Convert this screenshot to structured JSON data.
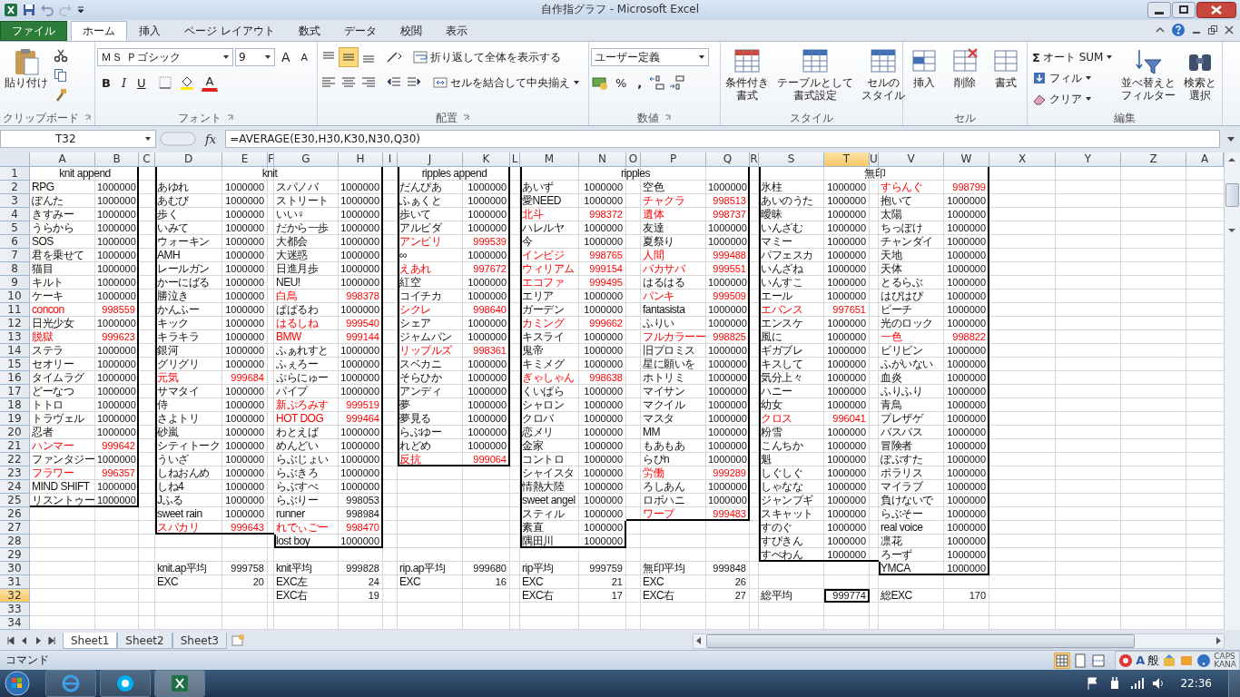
{
  "window": {
    "title": "自作指グラフ - Microsoft Excel"
  },
  "tabs": [
    {
      "label": "ファイル",
      "kind": "file",
      "selected": false
    },
    {
      "label": "ホーム",
      "kind": "tab",
      "selected": true
    },
    {
      "label": "挿入",
      "kind": "tab",
      "selected": false
    },
    {
      "label": "ページ レイアウト",
      "kind": "tab",
      "selected": false
    },
    {
      "label": "数式",
      "kind": "tab",
      "selected": false
    },
    {
      "label": "データ",
      "kind": "tab",
      "selected": false
    },
    {
      "label": "校閲",
      "kind": "tab",
      "selected": false
    },
    {
      "label": "表示",
      "kind": "tab",
      "selected": false
    }
  ],
  "ribbon": {
    "clipboard": {
      "label": "クリップボード",
      "paste": "貼り付け"
    },
    "font": {
      "label": "フォント",
      "font_name": "ＭＳ Ｐゴシック",
      "font_size": "9",
      "grow": "A",
      "shrink": "A",
      "bold": "B",
      "italic": "I",
      "underline": "U",
      "font_color": "A"
    },
    "alignment": {
      "label": "配置",
      "vertical": [
        {
          "selected": false
        },
        {
          "selected": true
        },
        {
          "selected": false
        }
      ],
      "wrap_text": "折り返して全体を表示する",
      "merge_center": "セルを結合して中央揃え"
    },
    "number": {
      "label": "数値",
      "format": "ユーザー定義",
      "percent": "%",
      "comma": ","
    },
    "styles": {
      "label": "スタイル",
      "buttons": [
        {
          "lines": [
            "条件付き",
            "書式"
          ]
        },
        {
          "lines": [
            "テーブルとして",
            "書式設定"
          ]
        },
        {
          "lines": [
            "セルの",
            "スタイル"
          ]
        }
      ]
    },
    "cells": {
      "label": "セル",
      "buttons": [
        "挿入",
        "削除",
        "書式"
      ]
    },
    "editing": {
      "label": "編集",
      "sum_symbol": "Σ",
      "autosum": "オート SUM",
      "fill": "フィル",
      "clear": "クリア",
      "sort": [
        "並べ替えと",
        "フィルター"
      ],
      "find": [
        "検索と",
        "選択"
      ]
    }
  },
  "formula_bar": {
    "name_box": "T32",
    "fx": "fx",
    "formula": "=AVERAGE(E30,H30,K30,N30,Q30)"
  },
  "sheet": {
    "columns": [
      {
        "label": "A",
        "selected": false
      },
      {
        "label": "B",
        "selected": false
      },
      {
        "label": "C",
        "selected": false
      },
      {
        "label": "D",
        "selected": false
      },
      {
        "label": "E",
        "selected": false
      },
      {
        "label": "F",
        "selected": false
      },
      {
        "label": "G",
        "selected": false
      },
      {
        "label": "H",
        "selected": false
      },
      {
        "label": "I",
        "selected": false
      },
      {
        "label": "J",
        "selected": false
      },
      {
        "label": "K",
        "selected": false
      },
      {
        "label": "L",
        "selected": false
      },
      {
        "label": "M",
        "selected": false
      },
      {
        "label": "N",
        "selected": false
      },
      {
        "label": "O",
        "selected": false
      },
      {
        "label": "P",
        "selected": false
      },
      {
        "label": "Q",
        "selected": false
      },
      {
        "label": "R",
        "selected": false
      },
      {
        "label": "S",
        "selected": false
      },
      {
        "label": "T",
        "selected": true
      },
      {
        "label": "U",
        "selected": false
      },
      {
        "label": "V",
        "selected": false
      },
      {
        "label": "W",
        "selected": false
      },
      {
        "label": "X",
        "selected": false
      },
      {
        "label": "Y",
        "selected": false
      },
      {
        "label": "Z",
        "selected": false
      },
      {
        "label": "A",
        "selected": false
      }
    ],
    "rows": [
      {
        "label": "1",
        "selected": false
      },
      {
        "label": "2",
        "selected": false
      },
      {
        "label": "3",
        "selected": false
      },
      {
        "label": "4",
        "selected": false
      },
      {
        "label": "5",
        "selected": false
      },
      {
        "label": "6",
        "selected": false
      },
      {
        "label": "7",
        "selected": false
      },
      {
        "label": "8",
        "selected": false
      },
      {
        "label": "9",
        "selected": false
      },
      {
        "label": "10",
        "selected": false
      },
      {
        "label": "11",
        "selected": false
      },
      {
        "label": "12",
        "selected": false
      },
      {
        "label": "13",
        "selected": false
      },
      {
        "label": "14",
        "selected": false
      },
      {
        "label": "15",
        "selected": false
      },
      {
        "label": "16",
        "selected": false
      },
      {
        "label": "17",
        "selected": false
      },
      {
        "label": "18",
        "selected": false
      },
      {
        "label": "19",
        "selected": false
      },
      {
        "label": "20",
        "selected": false
      },
      {
        "label": "21",
        "selected": false
      },
      {
        "label": "22",
        "selected": false
      },
      {
        "label": "23",
        "selected": false
      },
      {
        "label": "24",
        "selected": false
      },
      {
        "label": "25",
        "selected": false
      },
      {
        "label": "26",
        "selected": false
      },
      {
        "label": "27",
        "selected": false
      },
      {
        "label": "28",
        "selected": false
      },
      {
        "label": "29",
        "selected": false
      },
      {
        "label": "30",
        "selected": false
      },
      {
        "label": "31",
        "selected": false
      },
      {
        "label": "32",
        "selected": true
      },
      {
        "label": "33",
        "selected": false
      },
      {
        "label": "34",
        "selected": false
      }
    ]
  },
  "blocks": [
    {
      "title": "knit append",
      "lists": [
        {
          "songs": [
            {
              "name": "RPG",
              "score": "1000000",
              "highlighted": false
            },
            {
              "name": "ぽんた",
              "score": "1000000",
              "highlighted": false
            },
            {
              "name": "きすみー",
              "score": "1000000",
              "highlighted": false
            },
            {
              "name": "うらから",
              "score": "1000000",
              "highlighted": false
            },
            {
              "name": "SOS",
              "score": "1000000",
              "highlighted": false
            },
            {
              "name": "君を乗せて",
              "score": "1000000",
              "highlighted": false
            },
            {
              "name": "猫目",
              "score": "1000000",
              "highlighted": false
            },
            {
              "name": "キルト",
              "score": "1000000",
              "highlighted": false
            },
            {
              "name": "ケーキ",
              "score": "1000000",
              "highlighted": false
            },
            {
              "name": "concon",
              "score": "998559",
              "highlighted": true
            },
            {
              "name": "日光少女",
              "score": "1000000",
              "highlighted": false
            },
            {
              "name": "脱獄",
              "score": "999623",
              "highlighted": true
            },
            {
              "name": "ステラ",
              "score": "1000000",
              "highlighted": false
            },
            {
              "name": "セオリー",
              "score": "1000000",
              "highlighted": false
            },
            {
              "name": "タイムラグ",
              "score": "1000000",
              "highlighted": false
            },
            {
              "name": "どーなつ",
              "score": "1000000",
              "highlighted": false
            },
            {
              "name": "トトロ",
              "score": "1000000",
              "highlighted": false
            },
            {
              "name": "トラヴェル",
              "score": "1000000",
              "highlighted": false
            },
            {
              "name": "忍者",
              "score": "1000000",
              "highlighted": false
            },
            {
              "name": "ハンマー",
              "score": "999642",
              "highlighted": true
            },
            {
              "name": "ファンタジー",
              "score": "1000000",
              "highlighted": false
            },
            {
              "name": "フラワー",
              "score": "996357",
              "highlighted": true
            },
            {
              "name": "MIND SHIFT",
              "score": "1000000",
              "highlighted": false
            },
            {
              "name": "リスントゥー",
              "score": "1000000",
              "highlighted": false
            }
          ]
        }
      ]
    },
    {
      "title": "knit",
      "lists": [
        {
          "songs": [
            {
              "name": "あゆれ",
              "score": "1000000",
              "highlighted": false
            },
            {
              "name": "あむび",
              "score": "1000000",
              "highlighted": false
            },
            {
              "name": "歩く",
              "score": "1000000",
              "highlighted": false
            },
            {
              "name": "いみて",
              "score": "1000000",
              "highlighted": false
            },
            {
              "name": "ウォーキン",
              "score": "1000000",
              "highlighted": false
            },
            {
              "name": "AMH",
              "score": "1000000",
              "highlighted": false
            },
            {
              "name": "レールガン",
              "score": "1000000",
              "highlighted": false
            },
            {
              "name": "かーにばる",
              "score": "1000000",
              "highlighted": false
            },
            {
              "name": "勝泣き",
              "score": "1000000",
              "highlighted": false
            },
            {
              "name": "かんふー",
              "score": "1000000",
              "highlighted": false
            },
            {
              "name": "キック",
              "score": "1000000",
              "highlighted": false
            },
            {
              "name": "キラキラ",
              "score": "1000000",
              "highlighted": false
            },
            {
              "name": "銀河",
              "score": "1000000",
              "highlighted": false
            },
            {
              "name": "グリグリ",
              "score": "1000000",
              "highlighted": false
            },
            {
              "name": "元気",
              "score": "999684",
              "highlighted": true
            },
            {
              "name": "サマタイ",
              "score": "1000000",
              "highlighted": false
            },
            {
              "name": "侍",
              "score": "1000000",
              "highlighted": false
            },
            {
              "name": "さよトリ",
              "score": "1000000",
              "highlighted": false
            },
            {
              "name": "砂嵐",
              "score": "1000000",
              "highlighted": false
            },
            {
              "name": "シティトーク",
              "score": "1000000",
              "highlighted": false
            },
            {
              "name": "ういざ",
              "score": "1000000",
              "highlighted": false
            },
            {
              "name": "しねおんめ",
              "score": "1000000",
              "highlighted": false
            },
            {
              "name": "しね4",
              "score": "1000000",
              "highlighted": false
            },
            {
              "name": "Jふる",
              "score": "1000000",
              "highlighted": false
            },
            {
              "name": "sweet rain",
              "score": "1000000",
              "highlighted": false
            },
            {
              "name": "スパカリ",
              "score": "999643",
              "highlighted": true
            }
          ],
          "stats": [
            {
              "label": "knit.ap平均",
              "value": "999758",
              "selected": false
            },
            {
              "label": "EXC",
              "value": "20",
              "selected": false
            }
          ]
        },
        {
          "songs": [
            {
              "name": "スパノバ",
              "score": "1000000",
              "highlighted": false
            },
            {
              "name": "ストリート",
              "score": "1000000",
              "highlighted": false
            },
            {
              "name": "いい♀",
              "score": "1000000",
              "highlighted": false
            },
            {
              "name": "だから一歩",
              "score": "1000000",
              "highlighted": false
            },
            {
              "name": "大都会",
              "score": "1000000",
              "highlighted": false
            },
            {
              "name": "大迷惑",
              "score": "1000000",
              "highlighted": false
            },
            {
              "name": "日進月歩",
              "score": "1000000",
              "highlighted": false
            },
            {
              "name": "NEU!",
              "score": "1000000",
              "highlighted": false
            },
            {
              "name": "白鳥",
              "score": "998378",
              "highlighted": true
            },
            {
              "name": "ぱぱるわ",
              "score": "1000000",
              "highlighted": false
            },
            {
              "name": "はるしね",
              "score": "999540",
              "highlighted": true
            },
            {
              "name": "BMW",
              "score": "999144",
              "highlighted": true
            },
            {
              "name": "ふぁれすと",
              "score": "1000000",
              "highlighted": false
            },
            {
              "name": "ふぇろー",
              "score": "1000000",
              "highlighted": false
            },
            {
              "name": "ぷらにゅー",
              "score": "1000000",
              "highlighted": false
            },
            {
              "name": "パイプ",
              "score": "1000000",
              "highlighted": false
            },
            {
              "name": "新ぷろみす",
              "score": "999519",
              "highlighted": true
            },
            {
              "name": "HOT DOG",
              "score": "999464",
              "highlighted": true
            },
            {
              "name": "わとえば",
              "score": "1000000",
              "highlighted": false
            },
            {
              "name": "めんどい",
              "score": "1000000",
              "highlighted": false
            },
            {
              "name": "らぶじょい",
              "score": "1000000",
              "highlighted": false
            },
            {
              "name": "らぶきろ",
              "score": "1000000",
              "highlighted": false
            },
            {
              "name": "らぶすべ",
              "score": "1000000",
              "highlighted": false
            },
            {
              "name": "らぶりー",
              "score": "998053",
              "highlighted": false
            },
            {
              "name": "runner",
              "score": "998984",
              "highlighted": false
            },
            {
              "name": "れでぃごー",
              "score": "998470",
              "highlighted": true
            },
            {
              "name": "lost boy",
              "score": "1000000",
              "highlighted": false
            }
          ],
          "stats": [
            {
              "label": "knit平均",
              "value": "999828",
              "selected": false
            },
            {
              "label": "EXC左",
              "value": "24",
              "selected": false
            },
            {
              "label": "EXC右",
              "value": "19",
              "selected": false
            }
          ]
        }
      ]
    },
    {
      "title": "ripples append",
      "lists": [
        {
          "songs": [
            {
              "name": "だんぴあ",
              "score": "1000000",
              "highlighted": false
            },
            {
              "name": "ふぁくと",
              "score": "1000000",
              "highlighted": false
            },
            {
              "name": "歩いて",
              "score": "1000000",
              "highlighted": false
            },
            {
              "name": "アルビダ",
              "score": "1000000",
              "highlighted": false
            },
            {
              "name": "アンビリ",
              "score": "999539",
              "highlighted": true
            },
            {
              "name": "∞",
              "score": "1000000",
              "highlighted": false
            },
            {
              "name": "えあれ",
              "score": "997672",
              "highlighted": true
            },
            {
              "name": "紅空",
              "score": "1000000",
              "highlighted": false
            },
            {
              "name": "コイチカ",
              "score": "1000000",
              "highlighted": false
            },
            {
              "name": "シクレ",
              "score": "998640",
              "highlighted": true
            },
            {
              "name": "シェア",
              "score": "1000000",
              "highlighted": false
            },
            {
              "name": "ジャムパン",
              "score": "1000000",
              "highlighted": false
            },
            {
              "name": "リップルズ",
              "score": "998361",
              "highlighted": true
            },
            {
              "name": "スベカニ",
              "score": "1000000",
              "highlighted": false
            },
            {
              "name": "そらひか",
              "score": "1000000",
              "highlighted": false
            },
            {
              "name": "アンディ",
              "score": "1000000",
              "highlighted": false
            },
            {
              "name": "夢",
              "score": "1000000",
              "highlighted": false
            },
            {
              "name": "夢見る",
              "score": "1000000",
              "highlighted": false
            },
            {
              "name": "らぶゆー",
              "score": "1000000",
              "highlighted": false
            },
            {
              "name": "れどめ",
              "score": "1000000",
              "highlighted": false
            },
            {
              "name": "反抗",
              "score": "999064",
              "highlighted": true
            }
          ],
          "stats": [
            {
              "label": "rip.ap平均",
              "value": "999680",
              "selected": false
            },
            {
              "label": "EXC",
              "value": "16",
              "selected": false
            }
          ]
        }
      ]
    },
    {
      "title": "ripples",
      "lists": [
        {
          "songs": [
            {
              "name": "あいず",
              "score": "1000000",
              "highlighted": false
            },
            {
              "name": "愛NEED",
              "score": "1000000",
              "highlighted": false
            },
            {
              "name": "北斗",
              "score": "998372",
              "highlighted": true
            },
            {
              "name": "ハレルヤ",
              "score": "1000000",
              "highlighted": false
            },
            {
              "name": "今",
              "score": "1000000",
              "highlighted": false
            },
            {
              "name": "インビジ",
              "score": "998765",
              "highlighted": true
            },
            {
              "name": "ウィリアム",
              "score": "999154",
              "highlighted": true
            },
            {
              "name": "エコファ",
              "score": "999495",
              "highlighted": true
            },
            {
              "name": "エリア",
              "score": "1000000",
              "highlighted": false
            },
            {
              "name": "ガーデン",
              "score": "1000000",
              "highlighted": false
            },
            {
              "name": "カミング",
              "score": "999662",
              "highlighted": true
            },
            {
              "name": "キスライ",
              "score": "1000000",
              "highlighted": false
            },
            {
              "name": "鬼帝",
              "score": "1000000",
              "highlighted": false
            },
            {
              "name": "キミメグ",
              "score": "1000000",
              "highlighted": false
            },
            {
              "name": "ぎゃしゃん",
              "score": "998638",
              "highlighted": true
            },
            {
              "name": "くいぱら",
              "score": "1000000",
              "highlighted": false
            },
            {
              "name": "シャロン",
              "score": "1000000",
              "highlighted": false
            },
            {
              "name": "クロバ",
              "score": "1000000",
              "highlighted": false
            },
            {
              "name": "恋メリ",
              "score": "1000000",
              "highlighted": false
            },
            {
              "name": "金家",
              "score": "1000000",
              "highlighted": false
            },
            {
              "name": "コントロ",
              "score": "1000000",
              "highlighted": false
            },
            {
              "name": "シャイスタ",
              "score": "1000000",
              "highlighted": false
            },
            {
              "name": "情熱大陸",
              "score": "1000000",
              "highlighted": false
            },
            {
              "name": "sweet angel",
              "score": "1000000",
              "highlighted": false
            },
            {
              "name": "スティル",
              "score": "1000000",
              "highlighted": false
            },
            {
              "name": "素直",
              "score": "1000000",
              "highlighted": false
            },
            {
              "name": "隅田川",
              "score": "1000000",
              "highlighted": false
            }
          ],
          "stats": [
            {
              "label": "rip平均",
              "value": "999759",
              "selected": false
            },
            {
              "label": "EXC",
              "value": "21",
              "selected": false
            },
            {
              "label": "EXC右",
              "value": "17",
              "selected": false
            }
          ]
        },
        {
          "songs": [
            {
              "name": "空色",
              "score": "1000000",
              "highlighted": false
            },
            {
              "name": "チャクラ",
              "score": "998513",
              "highlighted": true
            },
            {
              "name": "遺体",
              "score": "998737",
              "highlighted": true
            },
            {
              "name": "友達",
              "score": "1000000",
              "highlighted": false
            },
            {
              "name": "夏祭り",
              "score": "1000000",
              "highlighted": false
            },
            {
              "name": "人間",
              "score": "999488",
              "highlighted": true
            },
            {
              "name": "バカサバ",
              "score": "999551",
              "highlighted": true
            },
            {
              "name": "はるはる",
              "score": "1000000",
              "highlighted": false
            },
            {
              "name": "パンキ",
              "score": "999509",
              "highlighted": true
            },
            {
              "name": "fantasista",
              "score": "1000000",
              "highlighted": false
            },
            {
              "name": "ふりい",
              "score": "1000000",
              "highlighted": false
            },
            {
              "name": "フルカラーー",
              "score": "998825",
              "highlighted": true
            },
            {
              "name": "旧プロミス",
              "score": "1000000",
              "highlighted": false
            },
            {
              "name": "星に願いを",
              "score": "1000000",
              "highlighted": false
            },
            {
              "name": "ホトリミ",
              "score": "1000000",
              "highlighted": false
            },
            {
              "name": "マイサン",
              "score": "1000000",
              "highlighted": false
            },
            {
              "name": "マクイル",
              "score": "1000000",
              "highlighted": false
            },
            {
              "name": "マスタ",
              "score": "1000000",
              "highlighted": false
            },
            {
              "name": "MM",
              "score": "1000000",
              "highlighted": false
            },
            {
              "name": "もあもあ",
              "score": "1000000",
              "highlighted": false
            },
            {
              "name": "らぴn",
              "score": "1000000",
              "highlighted": false
            },
            {
              "name": "労働",
              "score": "999289",
              "highlighted": true
            },
            {
              "name": "ろしあん",
              "score": "1000000",
              "highlighted": false
            },
            {
              "name": "ロボハニ",
              "score": "1000000",
              "highlighted": false
            },
            {
              "name": "ワープ",
              "score": "999483",
              "highlighted": true
            }
          ],
          "stats": [
            {
              "label": "無印平均",
              "value": "999848",
              "selected": false
            },
            {
              "label": "EXC",
              "value": "26",
              "selected": false
            },
            {
              "label": "EXC右",
              "value": "27",
              "selected": false
            }
          ]
        }
      ]
    },
    {
      "title": "無印",
      "lists": [
        {
          "songs": [
            {
              "name": "氷柱",
              "score": "1000000",
              "highlighted": false
            },
            {
              "name": "あいのうた",
              "score": "1000000",
              "highlighted": false
            },
            {
              "name": "曖昧",
              "score": "1000000",
              "highlighted": false
            },
            {
              "name": "いんざむ",
              "score": "1000000",
              "highlighted": false
            },
            {
              "name": "マミー",
              "score": "1000000",
              "highlighted": false
            },
            {
              "name": "パフェスカ",
              "score": "1000000",
              "highlighted": false
            },
            {
              "name": "いんざね",
              "score": "1000000",
              "highlighted": false
            },
            {
              "name": "いんすこ",
              "score": "1000000",
              "highlighted": false
            },
            {
              "name": "エール",
              "score": "1000000",
              "highlighted": false
            },
            {
              "name": "エバンス",
              "score": "997651",
              "highlighted": true
            },
            {
              "name": "エンスケ",
              "score": "1000000",
              "highlighted": false
            },
            {
              "name": "風に",
              "score": "1000000",
              "highlighted": false
            },
            {
              "name": "ギガブレ",
              "score": "1000000",
              "highlighted": false
            },
            {
              "name": "キスして",
              "score": "1000000",
              "highlighted": false
            },
            {
              "name": "気分上々",
              "score": "1000000",
              "highlighted": false
            },
            {
              "name": "ハニー",
              "score": "1000000",
              "highlighted": false
            },
            {
              "name": "幼女",
              "score": "1000000",
              "highlighted": false
            },
            {
              "name": "クロス",
              "score": "996041",
              "highlighted": true
            },
            {
              "name": "粉雪",
              "score": "1000000",
              "highlighted": false
            },
            {
              "name": "こんちか",
              "score": "1000000",
              "highlighted": false
            },
            {
              "name": "魁",
              "score": "1000000",
              "highlighted": false
            },
            {
              "name": "しぐしぐ",
              "score": "1000000",
              "highlighted": false
            },
            {
              "name": "しゃなな",
              "score": "1000000",
              "highlighted": false
            },
            {
              "name": "ジャンプギ",
              "score": "1000000",
              "highlighted": false
            },
            {
              "name": "スキャット",
              "score": "1000000",
              "highlighted": false
            },
            {
              "name": "すのぐ",
              "score": "1000000",
              "highlighted": false
            },
            {
              "name": "すぴきん",
              "score": "1000000",
              "highlighted": false
            },
            {
              "name": "すぺわん",
              "score": "1000000",
              "highlighted": false
            }
          ]
        },
        {
          "songs": [
            {
              "name": "すらんぐ",
              "score": "998799",
              "highlighted": true
            },
            {
              "name": "抱いて",
              "score": "1000000",
              "highlighted": false
            },
            {
              "name": "太陽",
              "score": "1000000",
              "highlighted": false
            },
            {
              "name": "ちっぽけ",
              "score": "1000000",
              "highlighted": false
            },
            {
              "name": "チャンダイ",
              "score": "1000000",
              "highlighted": false
            },
            {
              "name": "天地",
              "score": "1000000",
              "highlighted": false
            },
            {
              "name": "天体",
              "score": "1000000",
              "highlighted": false
            },
            {
              "name": "とるらぶ",
              "score": "1000000",
              "highlighted": false
            },
            {
              "name": "はぴはぴ",
              "score": "1000000",
              "highlighted": false
            },
            {
              "name": "ピーチ",
              "score": "1000000",
              "highlighted": false
            },
            {
              "name": "光のロック",
              "score": "1000000",
              "highlighted": false
            },
            {
              "name": "一色",
              "score": "998822",
              "highlighted": true
            },
            {
              "name": "ビリビン",
              "score": "1000000",
              "highlighted": false
            },
            {
              "name": "ふがいない",
              "score": "1000000",
              "highlighted": false
            },
            {
              "name": "血炎",
              "score": "1000000",
              "highlighted": false
            },
            {
              "name": "ふりふり",
              "score": "1000000",
              "highlighted": false
            },
            {
              "name": "青鳥",
              "score": "1000000",
              "highlighted": false
            },
            {
              "name": "プレザゲ",
              "score": "1000000",
              "highlighted": false
            },
            {
              "name": "バスバス",
              "score": "1000000",
              "highlighted": false
            },
            {
              "name": "冒険者",
              "score": "1000000",
              "highlighted": false
            },
            {
              "name": "ぽぷすた",
              "score": "1000000",
              "highlighted": false
            },
            {
              "name": "ポラリス",
              "score": "1000000",
              "highlighted": false
            },
            {
              "name": "マイラブ",
              "score": "1000000",
              "highlighted": false
            },
            {
              "name": "負けないで",
              "score": "1000000",
              "highlighted": false
            },
            {
              "name": "らぶそー",
              "score": "1000000",
              "highlighted": false
            },
            {
              "name": "real voice",
              "score": "1000000",
              "highlighted": false
            },
            {
              "name": "凛花",
              "score": "1000000",
              "highlighted": false
            },
            {
              "name": "ろーず",
              "score": "1000000",
              "highlighted": false
            },
            {
              "name": "YMCA",
              "score": "1000000",
              "highlighted": false
            }
          ]
        }
      ]
    }
  ],
  "totals": [
    {
      "label": "総平均",
      "value": "999774",
      "selected": true
    },
    {
      "label": "総EXC",
      "value": "170",
      "selected": false
    }
  ],
  "sheet_tabs": [
    {
      "label": "Sheet1",
      "selected": true
    },
    {
      "label": "Sheet2",
      "selected": false
    },
    {
      "label": "Sheet3",
      "selected": false
    }
  ],
  "status_bar": {
    "mode": "コマンド",
    "ime_mode": "A",
    "ime_input": "般",
    "caps": "CAPS",
    "kana": "KANA"
  },
  "taskbar": {
    "clock": "22:36"
  }
}
